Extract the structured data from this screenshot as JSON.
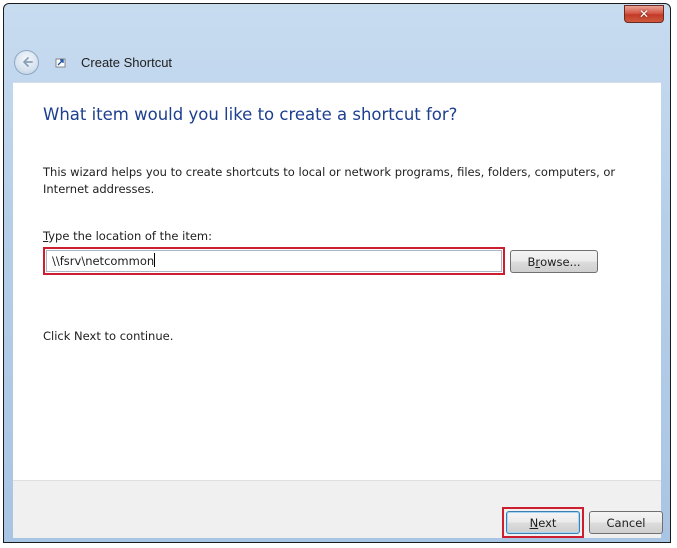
{
  "window": {
    "title": "Create Shortcut",
    "close_glyph": "✕"
  },
  "icons": {
    "back": "back-arrow-icon",
    "shortcut": "shortcut-icon",
    "close": "close-icon"
  },
  "wizard": {
    "heading": "What item would you like to create a shortcut for?",
    "description": "This wizard helps you to create shortcuts to local or network programs, files, folders, computers, or Internet addresses.",
    "location_label_mnemonic": "T",
    "location_label_rest": "ype the location of the item:",
    "location_value": "\\\\fsrv\\netcommon",
    "browse_label_pre": "B",
    "browse_label_mnemonic": "r",
    "browse_label_post": "owse...",
    "continue_hint": "Click Next to continue."
  },
  "footer": {
    "next_mnemonic": "N",
    "next_rest": "ext",
    "cancel_label": "Cancel"
  },
  "colors": {
    "heading": "#1d3f8f",
    "highlight": "#cc1e2e",
    "titlebar": "#b6cfe9",
    "footer_bg": "#f0f0f0"
  }
}
